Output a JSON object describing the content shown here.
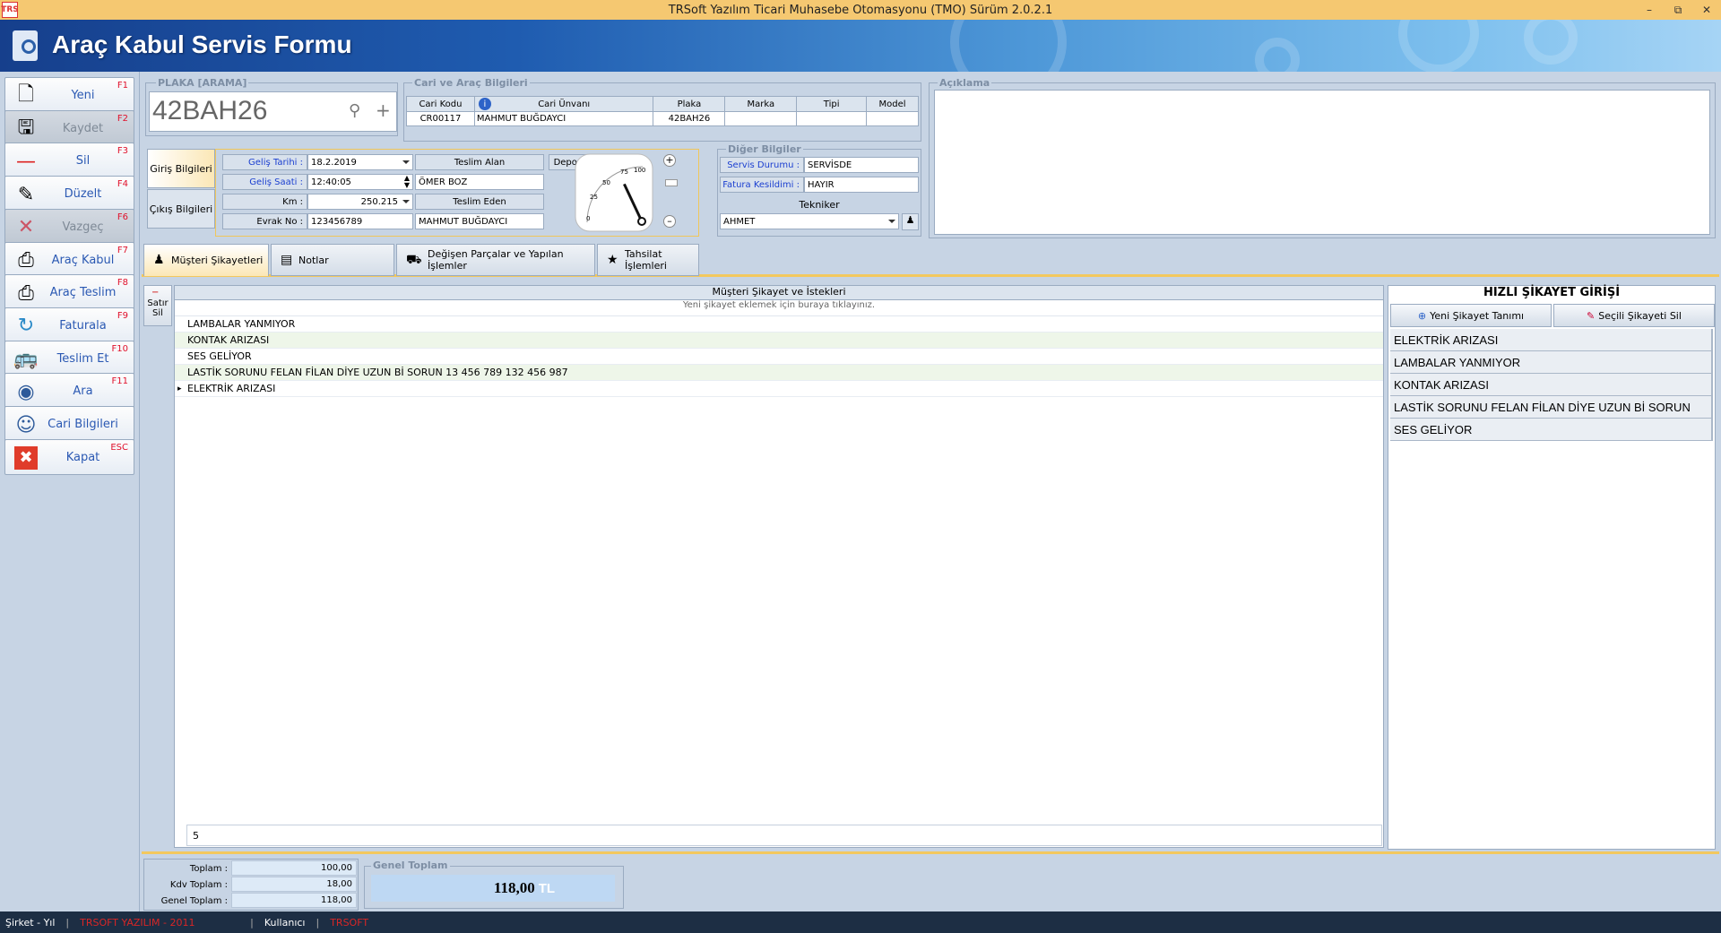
{
  "window": {
    "title": "TRSoft Yazılım Ticari Muhasebe Otomasyonu (TMO) Sürüm 2.0.2.1",
    "app_icon": "TRS"
  },
  "header": {
    "title": "Araç Kabul Servis Formu"
  },
  "sidebar": [
    {
      "label": "Yeni",
      "key": "F1",
      "icon": "new-document-icon",
      "disabled": false
    },
    {
      "label": "Kaydet",
      "key": "F2",
      "icon": "save-icon",
      "disabled": true
    },
    {
      "label": "Sil",
      "key": "F3",
      "icon": "delete-icon",
      "disabled": false
    },
    {
      "label": "Düzelt",
      "key": "F4",
      "icon": "edit-icon",
      "disabled": false
    },
    {
      "label": "Vazgeç",
      "key": "F6",
      "icon": "cancel-icon",
      "disabled": true
    },
    {
      "label": "Araç Kabul",
      "key": "F7",
      "icon": "printer-icon",
      "disabled": false
    },
    {
      "label": "Araç Teslim",
      "key": "F8",
      "icon": "printer-icon",
      "disabled": false
    },
    {
      "label": "Faturala",
      "key": "F9",
      "icon": "refresh-icon",
      "disabled": false
    },
    {
      "label": "Teslim Et",
      "key": "F10",
      "icon": "bus-icon",
      "disabled": false
    },
    {
      "label": "Ara",
      "key": "F11",
      "icon": "binoculars-icon",
      "disabled": false
    },
    {
      "label": "Cari Bilgileri",
      "key": "",
      "icon": "users-icon",
      "disabled": false
    },
    {
      "label": "Kapat",
      "key": "ESC",
      "icon": "close-icon",
      "disabled": false
    }
  ],
  "plate_search": {
    "title": "PLAKA [ARAMA]",
    "value": "42BAH26"
  },
  "cari": {
    "title": "Cari ve Araç Bilgileri",
    "headers": [
      "Cari Kodu",
      "Cari Ünvanı",
      "Plaka",
      "Marka",
      "Tipi",
      "Model"
    ],
    "values": [
      "CR00117",
      "MAHMUT BUĞDAYCI",
      "42BAH26",
      "",
      "",
      ""
    ]
  },
  "aciklama": {
    "title": "Açıklama",
    "value": ""
  },
  "vtabs": {
    "giris": "Giriş Bilgileri",
    "cikis": "Çıkış Bilgileri"
  },
  "giris": {
    "gelis_tarihi_label": "Geliş Tarihi :",
    "gelis_tarihi": "18.2.2019",
    "gelis_saati_label": "Geliş Saati :",
    "gelis_saati": "12:40:05",
    "km_label": "Km :",
    "km": "250.215",
    "evrak_label": "Evrak No :",
    "evrak": "123456789",
    "teslim_alan_label": "Teslim Alan",
    "teslim_alan": "ÖMER BOZ",
    "teslim_eden_label": "Teslim Eden",
    "teslim_eden": "MAHMUT BUĞDAYCI",
    "depo_label": "Depo :"
  },
  "gauge": {
    "ticks": [
      "0",
      "25",
      "50",
      "75",
      "100"
    ],
    "value_percent": 72
  },
  "diger": {
    "title": "Diğer Bilgiler",
    "servis_label": "Servis Durumu :",
    "servis": "SERVİSDE",
    "fatura_label": "Fatura Kesildimi :",
    "fatura": "HAYIR",
    "teknisyen_label": "Tekniker",
    "teknisyen": "AHMET"
  },
  "tabs": [
    "Müşteri Şikayetleri",
    "Notlar",
    "Değişen Parçalar ve Yapılan İşlemler",
    "Tahsilat İşlemleri"
  ],
  "grid": {
    "delete_row": "Satır Sil",
    "header": "Müşteri Şikayet ve İstekleri",
    "new_row_hint": "Yeni şikayet eklemek için buraya tıklayınız.",
    "rows": [
      "LAMBALAR YANMIYOR",
      "KONTAK ARIZASI",
      "SES GELİYOR",
      "LASTİK SORUNU FELAN FİLAN DİYE UZUN Bİ SORUN 13 456 789 132 456 987",
      "ELEKTRİK ARIZASI"
    ],
    "footer_count": "5"
  },
  "hizli": {
    "title": "HIZLI ŞİKAYET GİRİŞİ",
    "add_btn": "Yeni Şikayet Tanımı",
    "del_btn": "Seçili Şikayeti Sil",
    "items": [
      "ELEKTRİK ARIZASI",
      "LAMBALAR YANMIYOR",
      "KONTAK ARIZASI",
      "LASTİK SORUNU FELAN FİLAN DİYE UZUN Bİ SORUN",
      "SES GELİYOR"
    ]
  },
  "totals": {
    "toplam_label": "Toplam :",
    "toplam": "100,00",
    "kdv_label": "Kdv Toplam :",
    "kdv": "18,00",
    "genel_label": "Genel Toplam :",
    "genel": "118,00",
    "genel_box_title": "Genel Toplam",
    "genel_box_value": "118,00",
    "currency": "TL"
  },
  "status": {
    "sirket_label": "Şirket - Yıl",
    "sirket": "TRSOFT YAZILIM - 2011",
    "kullanici_label": "Kullanıcı",
    "kullanici": "TRSOFT"
  }
}
